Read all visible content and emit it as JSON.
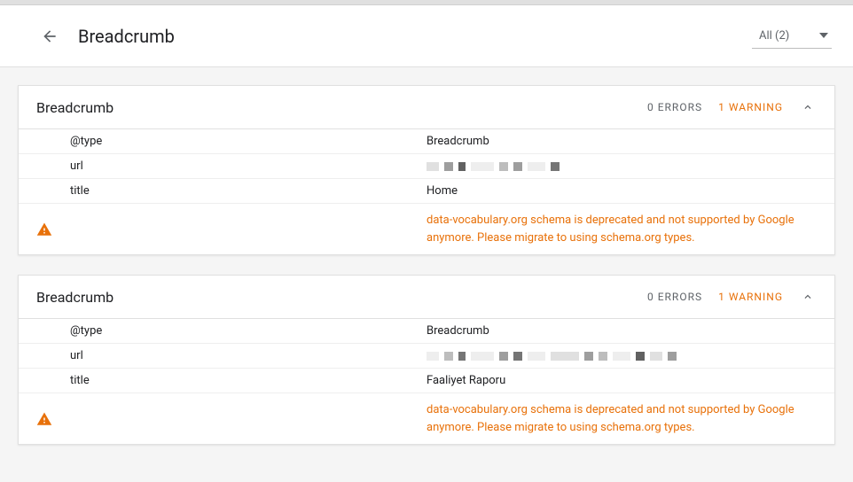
{
  "header": {
    "title": "Breadcrumb",
    "filter_label": "All (2)"
  },
  "cards": [
    {
      "title": "Breadcrumb",
      "errors_label": "0 ERRORS",
      "warnings_label": "1 WARNING",
      "fields": {
        "type_key": "@type",
        "type_val": "Breadcrumb",
        "url_key": "url",
        "title_key": "title",
        "title_val": "Home"
      },
      "warning_text": "data-vocabulary.org schema is deprecated and not supported by Google anymore. Please migrate to using schema.org types."
    },
    {
      "title": "Breadcrumb",
      "errors_label": "0 ERRORS",
      "warnings_label": "1 WARNING",
      "fields": {
        "type_key": "@type",
        "type_val": "Breadcrumb",
        "url_key": "url",
        "title_key": "title",
        "title_val": "Faaliyet Raporu"
      },
      "warning_text": "data-vocabulary.org schema is deprecated and not supported by Google anymore. Please migrate to using schema.org types."
    }
  ]
}
